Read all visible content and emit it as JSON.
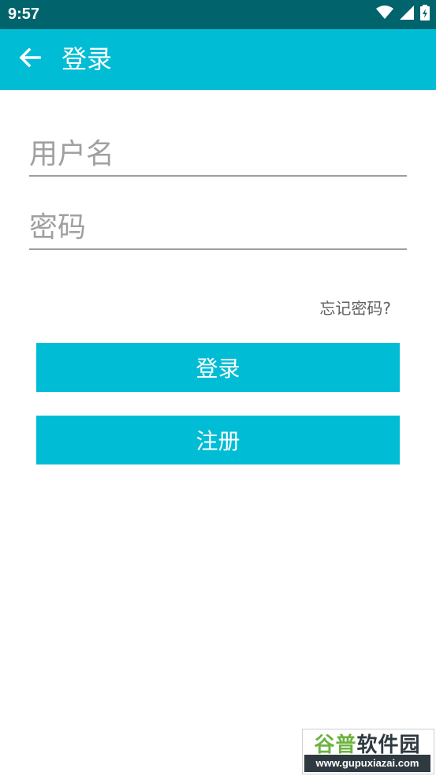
{
  "status_bar": {
    "time": "9:57",
    "icons": [
      "wifi-icon",
      "signal-icon",
      "battery-icon"
    ]
  },
  "app_bar": {
    "title": "登录",
    "back_icon": "arrow-left-icon"
  },
  "form": {
    "username_placeholder": "用户名",
    "password_placeholder": "密码",
    "forgot_password_label": "忘记密码?",
    "login_button_label": "登录",
    "register_button_label": "注册"
  },
  "watermark": {
    "brand_part1": "谷普",
    "brand_part2": "软件园",
    "url": "www.gupuxiazai.com"
  },
  "colors": {
    "status_bar": "#01636b",
    "primary": "#00bcd4",
    "underline": "#9e9e9e",
    "hint_text": "#a0a0a0"
  }
}
